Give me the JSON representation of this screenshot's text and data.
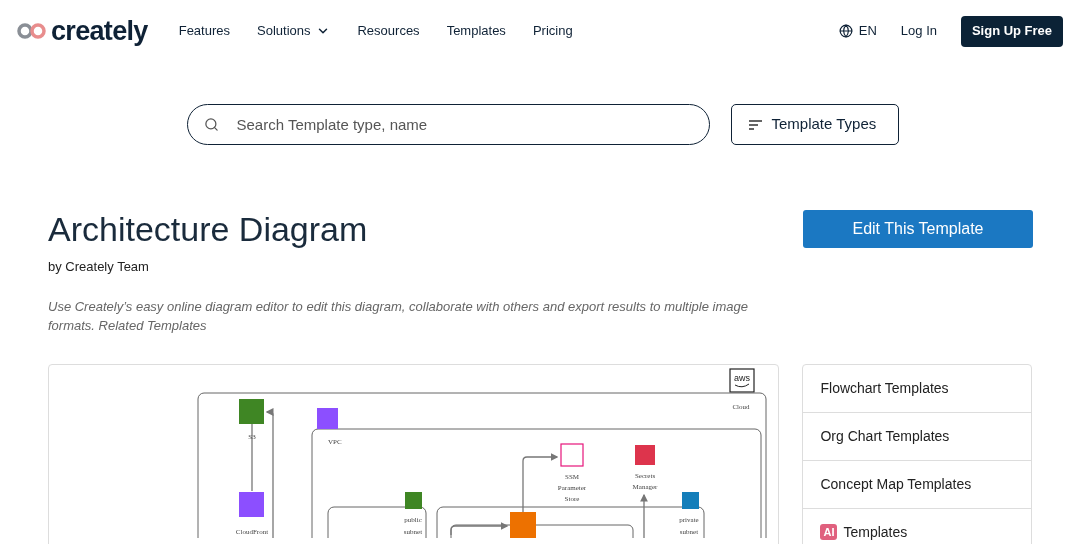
{
  "header": {
    "logo": "creately",
    "nav": [
      {
        "label": "Features",
        "dropdown": false
      },
      {
        "label": "Solutions",
        "dropdown": true
      },
      {
        "label": "Resources",
        "dropdown": false
      },
      {
        "label": "Templates",
        "dropdown": false
      },
      {
        "label": "Pricing",
        "dropdown": false
      }
    ],
    "language": "EN",
    "login": "Log In",
    "signup": "Sign Up Free"
  },
  "search": {
    "placeholder": "Search Template type, name",
    "filter_button": "Template Types"
  },
  "template": {
    "title": "Architecture Diagram",
    "author": "by Creately Team",
    "edit_button": "Edit This Template",
    "description": "Use Creately’s easy online diagram editor to edit this diagram, collaborate with others and export results to multiple image formats. Related Templates"
  },
  "diagram": {
    "logo": "aws",
    "groups": [
      {
        "label": [
          "Cloud"
        ]
      },
      {
        "label": [
          "VPC"
        ]
      },
      {
        "label": [
          "public",
          "subnet"
        ]
      },
      {
        "label": [
          "private",
          "subnet"
        ]
      }
    ],
    "services": [
      {
        "label": [
          "S3"
        ]
      },
      {
        "label": [
          "CloudFront"
        ]
      },
      {
        "label": [
          "SSM",
          "Parameter",
          "Store"
        ]
      },
      {
        "label": [
          "Secrets",
          "Manager"
        ]
      }
    ]
  },
  "related": [
    {
      "label": "Flowchart Templates"
    },
    {
      "label": "Org Chart Templates"
    },
    {
      "label": "Concept Map Templates"
    },
    {
      "label": "Templates",
      "badge": "AI"
    }
  ]
}
